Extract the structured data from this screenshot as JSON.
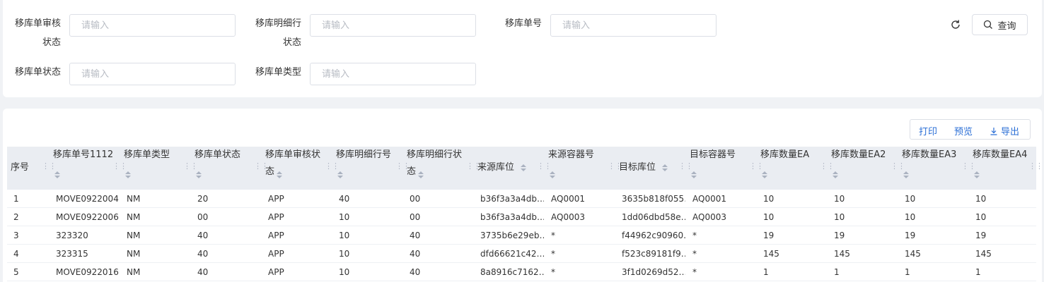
{
  "filters": {
    "audit_status": {
      "label_line1": "移库单审核",
      "label_line2": "状态",
      "placeholder": "请输入"
    },
    "line_status": {
      "label_line1": "移库明细行",
      "label_line2": "状态",
      "placeholder": "请输入"
    },
    "order_no": {
      "label": "移库单号",
      "placeholder": "请输入"
    },
    "order_status": {
      "label": "移库单状态",
      "placeholder": "请输入"
    },
    "order_type": {
      "label": "移库单类型",
      "placeholder": "请输入"
    }
  },
  "actions": {
    "refresh_icon": "refresh-icon",
    "query_label": "查询",
    "query_icon": "search-icon"
  },
  "toolbar": {
    "print": "打印",
    "preview": "预览",
    "export": "导出",
    "export_icon": "download-icon"
  },
  "columns": [
    {
      "line1": "序号",
      "line2": ""
    },
    {
      "line1": "移库单号1112",
      "line2": ""
    },
    {
      "line1": "移库单类型",
      "line2": ""
    },
    {
      "line1": "移库单状态",
      "line2": ""
    },
    {
      "line1": "移库单审核状",
      "line2": "态"
    },
    {
      "line1": "移库明细行号",
      "line2": ""
    },
    {
      "line1": "移库明细行状",
      "line2": "态"
    },
    {
      "line1": "来源库位",
      "line2": ""
    },
    {
      "line1": "来源容器号",
      "line2": ""
    },
    {
      "line1": "目标库位",
      "line2": ""
    },
    {
      "line1": "目标容器号",
      "line2": ""
    },
    {
      "line1": "移库数量EA",
      "line2": ""
    },
    {
      "line1": "移库数量EA2",
      "line2": ""
    },
    {
      "line1": "移库数量EA3",
      "line2": ""
    },
    {
      "line1": "移库数量EA4",
      "line2": ""
    }
  ],
  "rows": [
    [
      "1",
      "MOVE0922004",
      "NM",
      "20",
      "APP",
      "40",
      "00",
      "b36f3a3a4db…",
      "AQ0001",
      "3635b818f055…",
      "AQ0001",
      "10",
      "10",
      "10",
      "10"
    ],
    [
      "2",
      "MOVE0922006",
      "NM",
      "00",
      "APP",
      "10",
      "00",
      "b36f3a3a4db…",
      "AQ0003",
      "1dd06dbd58e…",
      "AQ0003",
      "10",
      "10",
      "10",
      "10"
    ],
    [
      "3",
      "323320",
      "NM",
      "40",
      "APP",
      "10",
      "40",
      "3735b6e29eb…",
      "*",
      "f44962c90960…",
      "*",
      "19",
      "19",
      "19",
      "19"
    ],
    [
      "4",
      "323315",
      "NM",
      "40",
      "APP",
      "10",
      "40",
      "dfd66621c42…",
      "*",
      "f523c89181f9…",
      "*",
      "145",
      "145",
      "145",
      "145"
    ],
    [
      "5",
      "MOVE0922016",
      "NM",
      "40",
      "APP",
      "10",
      "40",
      "8a8916c7162…",
      "*",
      "3f1d0269d52…",
      "*",
      "1",
      "1",
      "1",
      "1"
    ]
  ]
}
